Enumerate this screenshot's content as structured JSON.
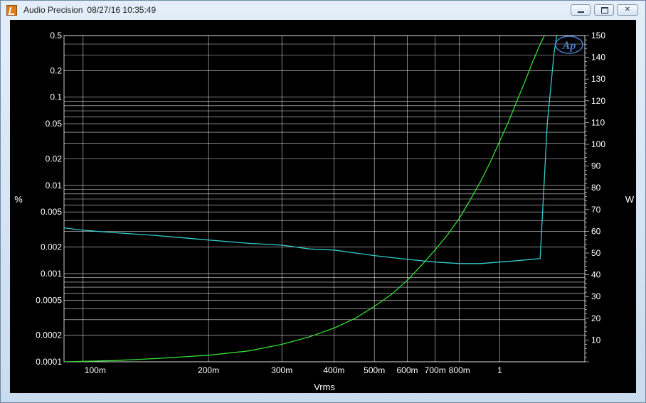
{
  "window": {
    "app_name": "Audio Precision",
    "timestamp": "08/27/16 10:35:49",
    "icon": "ap-app-icon",
    "controls": [
      "minimize-icon",
      "maximize-icon",
      "close-icon"
    ]
  },
  "colors": {
    "background": "#000000",
    "grid": "#ffffff",
    "thd_series": "#33cccc",
    "power_series": "#33dd33",
    "logo": "#4a7fd0"
  },
  "logo_text": "Ap",
  "chart_data": {
    "type": "line",
    "xlabel": "Vrms",
    "ylabel_left": "%",
    "ylabel_right": "W",
    "x_scale": "log",
    "xlim": [
      0.09,
      1.6
    ],
    "ylim_left": [
      0.0001,
      0.5
    ],
    "y_scale_left": "log",
    "ylim_right": [
      0,
      150
    ],
    "grid": true,
    "x_ticks": [
      {
        "value": 0.1,
        "label": "100m"
      },
      {
        "value": 0.2,
        "label": "200m"
      },
      {
        "value": 0.3,
        "label": "300m"
      },
      {
        "value": 0.4,
        "label": "400m"
      },
      {
        "value": 0.5,
        "label": "500m"
      },
      {
        "value": 0.6,
        "label": "600m"
      },
      {
        "value": 0.7,
        "label": "700m"
      },
      {
        "value": 0.8,
        "label": "800m"
      },
      {
        "value": 1.0,
        "label": "1"
      }
    ],
    "y_ticks_left": [
      {
        "value": 0.0001,
        "label": "0.0001"
      },
      {
        "value": 0.0002,
        "label": "0.0002"
      },
      {
        "value": 0.0005,
        "label": "0.0005"
      },
      {
        "value": 0.001,
        "label": "0.001"
      },
      {
        "value": 0.002,
        "label": "0.002"
      },
      {
        "value": 0.005,
        "label": "0.005"
      },
      {
        "value": 0.01,
        "label": "0.01"
      },
      {
        "value": 0.02,
        "label": "0.02"
      },
      {
        "value": 0.05,
        "label": "0.05"
      },
      {
        "value": 0.1,
        "label": "0.1"
      },
      {
        "value": 0.2,
        "label": "0.2"
      },
      {
        "value": 0.5,
        "label": "0.5"
      }
    ],
    "y_ticks_right": [
      {
        "value": 10,
        "label": "10"
      },
      {
        "value": 20,
        "label": "20"
      },
      {
        "value": 30,
        "label": "30"
      },
      {
        "value": 40,
        "label": "40"
      },
      {
        "value": 50,
        "label": "50"
      },
      {
        "value": 60,
        "label": "60"
      },
      {
        "value": 70,
        "label": "70"
      },
      {
        "value": 80,
        "label": "80"
      },
      {
        "value": 90,
        "label": "90"
      },
      {
        "value": 100,
        "label": "100"
      },
      {
        "value": 110,
        "label": "110"
      },
      {
        "value": 120,
        "label": "120"
      },
      {
        "value": 130,
        "label": "130"
      },
      {
        "value": 140,
        "label": "140"
      },
      {
        "value": 150,
        "label": "150"
      }
    ],
    "series": [
      {
        "axis": "left",
        "color": "#33cccc",
        "points": [
          [
            0.09,
            0.0033
          ],
          [
            0.1,
            0.0031
          ],
          [
            0.12,
            0.0029
          ],
          [
            0.15,
            0.0027
          ],
          [
            0.2,
            0.0024
          ],
          [
            0.25,
            0.0022
          ],
          [
            0.3,
            0.0021
          ],
          [
            0.35,
            0.0019
          ],
          [
            0.4,
            0.00185
          ],
          [
            0.5,
            0.0016
          ],
          [
            0.6,
            0.00145
          ],
          [
            0.7,
            0.00135
          ],
          [
            0.8,
            0.0013
          ],
          [
            0.9,
            0.0013
          ],
          [
            1.0,
            0.00135
          ],
          [
            1.1,
            0.0014
          ],
          [
            1.25,
            0.00148
          ],
          [
            1.3,
            0.05
          ],
          [
            1.35,
            0.32
          ],
          [
            1.37,
            0.5
          ]
        ]
      },
      {
        "axis": "right",
        "color": "#33dd33",
        "points": [
          [
            0.09,
            0.0
          ],
          [
            0.12,
            0.6
          ],
          [
            0.15,
            1.5
          ],
          [
            0.2,
            3.0
          ],
          [
            0.25,
            5.0
          ],
          [
            0.3,
            8.0
          ],
          [
            0.35,
            11.5
          ],
          [
            0.4,
            15.5
          ],
          [
            0.45,
            20.0
          ],
          [
            0.5,
            25.5
          ],
          [
            0.55,
            31.0
          ],
          [
            0.6,
            37.5
          ],
          [
            0.65,
            44.5
          ],
          [
            0.7,
            51.5
          ],
          [
            0.75,
            58.5
          ],
          [
            0.8,
            66.0
          ],
          [
            0.85,
            74.5
          ],
          [
            0.9,
            83.0
          ],
          [
            0.95,
            92.0
          ],
          [
            1.0,
            101.5
          ],
          [
            1.05,
            110.5
          ],
          [
            1.1,
            120.0
          ],
          [
            1.15,
            129.0
          ],
          [
            1.2,
            138.0
          ],
          [
            1.25,
            146.0
          ],
          [
            1.28,
            150.0
          ]
        ]
      }
    ]
  }
}
